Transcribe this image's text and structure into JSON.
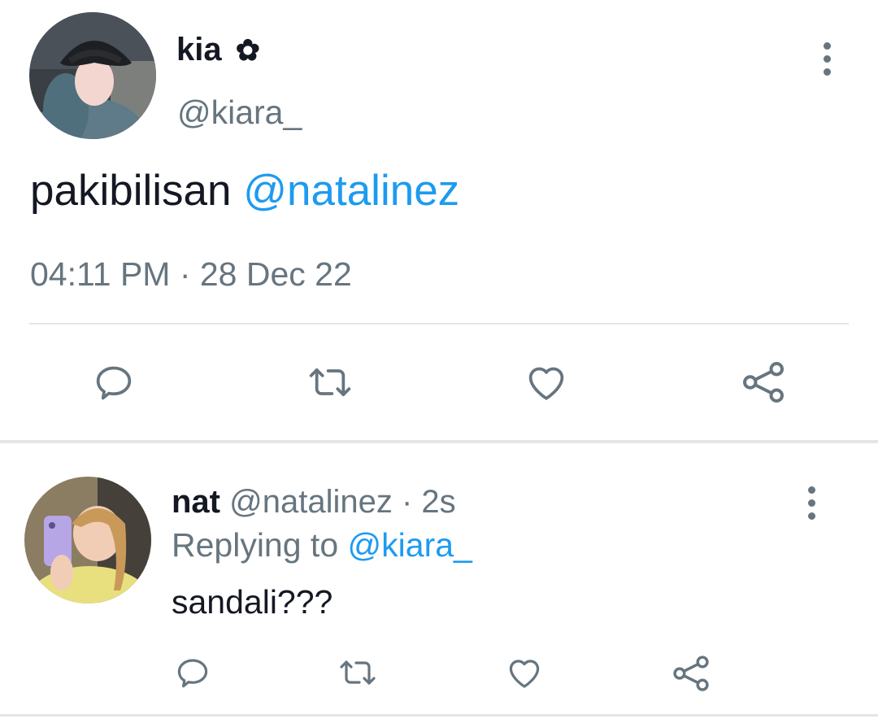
{
  "tweet": {
    "display_name": "kia",
    "name_emoji": "✿",
    "handle": "@kiara_",
    "text": "pakibilisan",
    "mention": "@natalinez",
    "timestamp": "04:11 PM · 28 Dec 22"
  },
  "reply": {
    "display_name": "nat",
    "handle": "@natalinez",
    "time": "· 2s",
    "replying_label": "Replying to",
    "replying_handle": "@kiara_",
    "text": "sandali???"
  },
  "icons": {
    "reply": "comment-icon",
    "retweet": "retweet-icon",
    "like": "heart-icon",
    "share": "share-icon",
    "more": "more-vertical-icon"
  },
  "colors": {
    "link": "#1d9bf0",
    "muted": "#66757f",
    "text": "#141823",
    "divider": "#e3e6e8"
  }
}
